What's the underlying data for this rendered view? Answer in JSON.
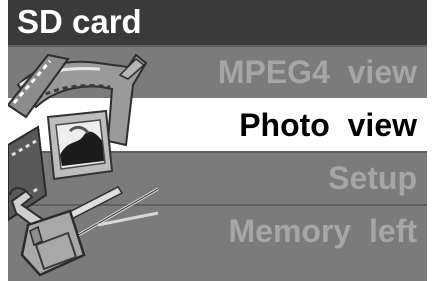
{
  "title": "SD card",
  "menu": {
    "items": [
      {
        "label": "MPEG4  view",
        "selected": false,
        "icon": "film-strip-icon"
      },
      {
        "label": "Photo  view",
        "selected": true,
        "icon": "photo-frame-icon"
      },
      {
        "label": "Setup",
        "selected": false,
        "icon": "tools-icon"
      },
      {
        "label": "Memory  left",
        "selected": false,
        "icon": "sd-card-icon"
      }
    ]
  },
  "colors": {
    "background": "#7b7b7b",
    "title_bar": "#3a3a3a",
    "title_text": "#ffffff",
    "item_text": "#a6a6a6",
    "selected_background": "#ffffff",
    "selected_text": "#000000"
  }
}
